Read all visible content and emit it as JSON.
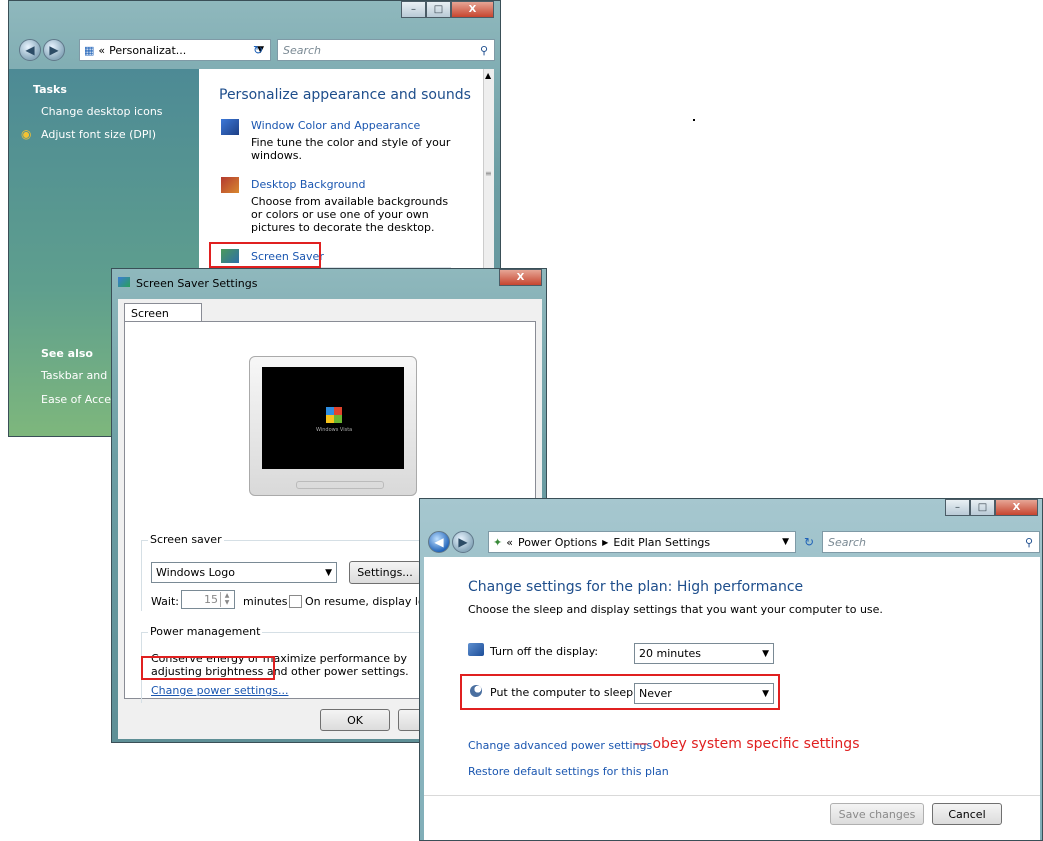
{
  "personalize": {
    "address_prefix": "«",
    "address_text": "Personalizat...",
    "search_placeholder": "Search",
    "tasks_heading": "Tasks",
    "task_items": [
      "Change desktop icons",
      "Adjust font size (DPI)"
    ],
    "see_also_heading": "See also",
    "see_also_items": [
      "Taskbar and St",
      "Ease of Access"
    ],
    "main_title": "Personalize appearance and sounds",
    "items": [
      {
        "title": "Window Color and Appearance",
        "desc": "Fine tune the color and style of your windows."
      },
      {
        "title": "Desktop Background",
        "desc": "Choose from available backgrounds or colors or use one of your own pictures to decorate the desktop."
      },
      {
        "title": "Screen Saver",
        "desc": ""
      }
    ]
  },
  "screensaver": {
    "title": "Screen Saver Settings",
    "tab": "Screen Saver",
    "monitor_logo": "Windows Vista",
    "group_screen_saver": "Screen saver",
    "selected_saver": "Windows Logo",
    "settings_button": "Settings...",
    "wait_label": "Wait:",
    "wait_value": "15",
    "minutes_label": "minutes",
    "resume_label": "On resume, display logo",
    "group_power": "Power management",
    "power_text": "Conserve energy or maximize performance by adjusting brightness and other power settings.",
    "power_link": "Change power settings...",
    "ok_button": "OK",
    "cancel_button": "C"
  },
  "power": {
    "breadcrumb_prefix": "«",
    "breadcrumb": [
      "Power Options",
      "Edit Plan Settings"
    ],
    "search_placeholder": "Search",
    "title": "Change settings for the plan: High performance",
    "subtitle": "Choose the sleep and display settings that you want your computer to use.",
    "display_label": "Turn off the display:",
    "display_value": "20 minutes",
    "sleep_label": "Put the computer to sleep:",
    "sleep_value": "Never",
    "advanced_link": "Change advanced power settings",
    "annotation": "— obey system specific settings",
    "restore_link": "Restore default settings for this plan",
    "save_button": "Save changes",
    "cancel_button": "Cancel"
  },
  "colors": {
    "link": "#1a56b0",
    "highlight": "#e02020",
    "title_blue": "#1e4e8c"
  }
}
